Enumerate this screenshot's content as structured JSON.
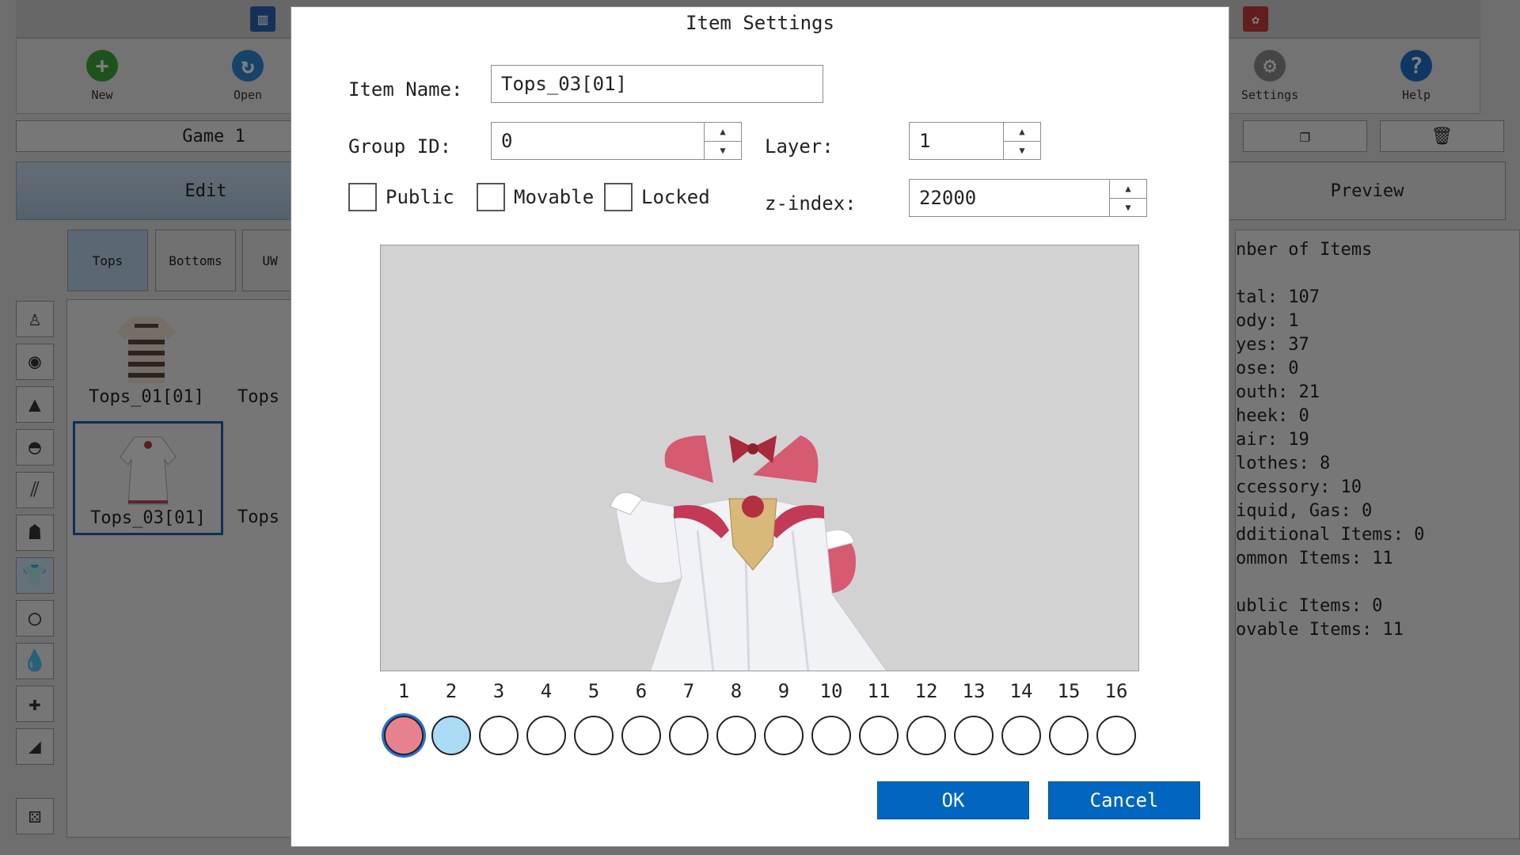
{
  "app": {
    "toolbar": {
      "new_label": "New",
      "open_label": "Open",
      "settings_label": "Settings",
      "help_label": "Help"
    },
    "game_name": "Game 1",
    "edit_tab": "Edit",
    "preview_tab": "Preview",
    "categories": [
      "Tops",
      "Bottoms",
      "UW"
    ],
    "items": [
      {
        "label": "Tops_01[01]"
      },
      {
        "label": "Tops_03[01]"
      },
      {
        "label": "Tops"
      },
      {
        "label": "Tops"
      }
    ],
    "stats_lines": [
      "nber of Items",
      "",
      "tal: 107",
      "ody: 1",
      "yes: 37",
      "ose: 0",
      "outh: 21",
      "heek: 0",
      "air: 19",
      "lothes: 8",
      "ccessory: 10",
      "iquid, Gas: 0",
      "dditional Items: 0",
      "ommon Items: 11",
      "",
      "ublic Items: 0",
      "ovable Items: 11"
    ]
  },
  "dialog": {
    "title": "Item Settings",
    "item_name_label": "Item Name:",
    "item_name_value": "Tops_03[01]",
    "group_id_label": "Group ID:",
    "group_id_value": "0",
    "layer_label": "Layer:",
    "layer_value": "1",
    "public_label": "Public",
    "movable_label": "Movable",
    "locked_label": "Locked",
    "zindex_label": "z-index:",
    "zindex_value": "22000",
    "slots": [
      {
        "num": "1",
        "color": "#e8818f",
        "selected": true
      },
      {
        "num": "2",
        "color": "#aadcf7",
        "selected": false
      },
      {
        "num": "3",
        "color": "#ffffff",
        "selected": false
      },
      {
        "num": "4",
        "color": "#ffffff",
        "selected": false
      },
      {
        "num": "5",
        "color": "#ffffff",
        "selected": false
      },
      {
        "num": "6",
        "color": "#ffffff",
        "selected": false
      },
      {
        "num": "7",
        "color": "#ffffff",
        "selected": false
      },
      {
        "num": "8",
        "color": "#ffffff",
        "selected": false
      },
      {
        "num": "9",
        "color": "#ffffff",
        "selected": false
      },
      {
        "num": "10",
        "color": "#ffffff",
        "selected": false
      },
      {
        "num": "11",
        "color": "#ffffff",
        "selected": false
      },
      {
        "num": "12",
        "color": "#ffffff",
        "selected": false
      },
      {
        "num": "13",
        "color": "#ffffff",
        "selected": false
      },
      {
        "num": "14",
        "color": "#ffffff",
        "selected": false
      },
      {
        "num": "15",
        "color": "#ffffff",
        "selected": false
      },
      {
        "num": "16",
        "color": "#ffffff",
        "selected": false
      }
    ],
    "ok_label": "OK",
    "cancel_label": "Cancel"
  }
}
